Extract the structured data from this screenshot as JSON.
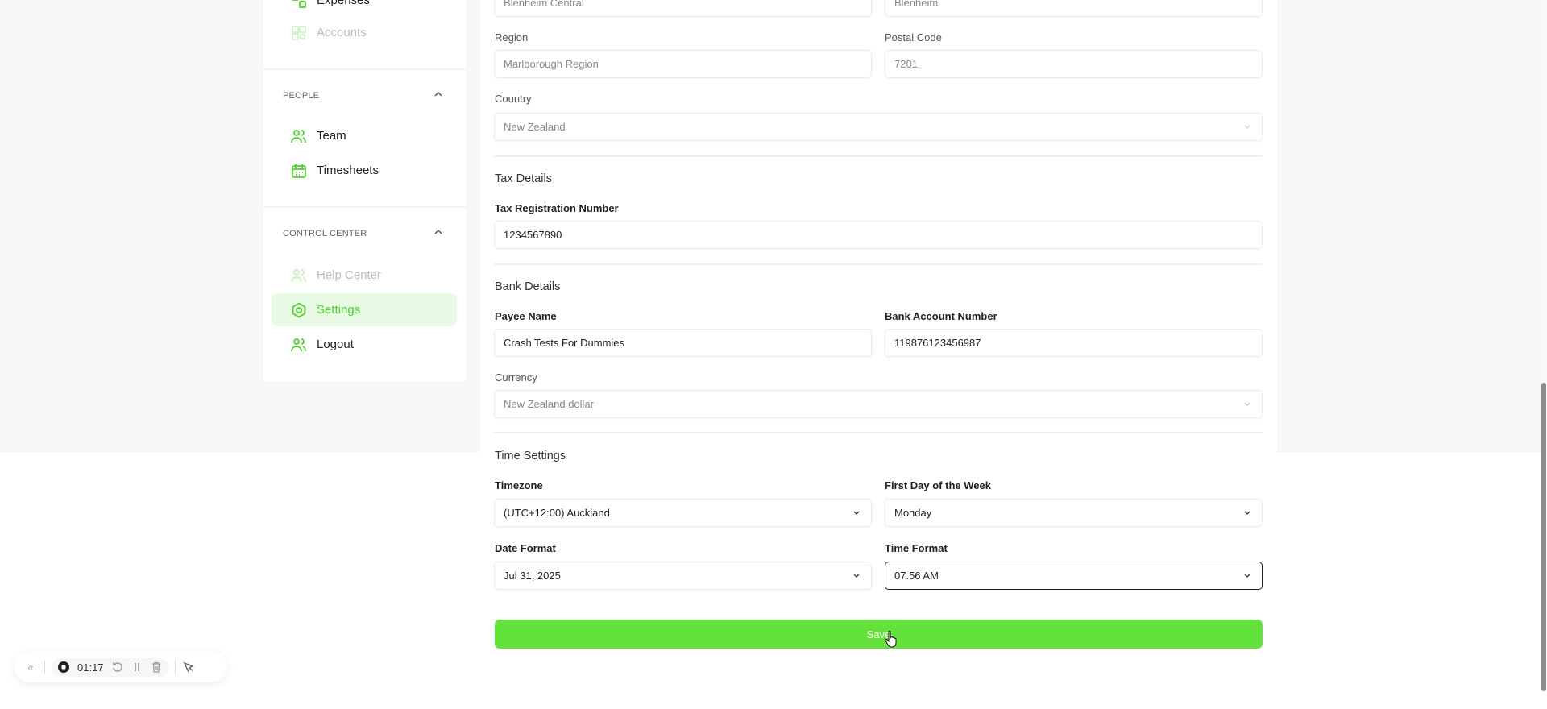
{
  "sidebar": {
    "items_top": [
      {
        "label": "Expenses"
      },
      {
        "label": "Accounts"
      }
    ],
    "people": {
      "title": "PEOPLE",
      "items": [
        {
          "label": "Team"
        },
        {
          "label": "Timesheets"
        }
      ]
    },
    "control": {
      "title": "CONTROL CENTER",
      "items": [
        {
          "label": "Help Center"
        },
        {
          "label": "Settings"
        },
        {
          "label": "Logout"
        }
      ]
    }
  },
  "address": {
    "suburb": "Blenheim Central",
    "city": "Blenheim",
    "region_label": "Region",
    "region": "Marlborough Region",
    "postal_label": "Postal Code",
    "postal": "7201",
    "country_label": "Country",
    "country": "New Zealand"
  },
  "tax": {
    "title": "Tax Details",
    "reg_label": "Tax Registration Number",
    "reg": "1234567890"
  },
  "bank": {
    "title": "Bank Details",
    "payee_label": "Payee Name",
    "payee": "Crash Tests For Dummies",
    "account_label": "Bank Account Number",
    "account": "119876123456987",
    "currency_label": "Currency",
    "currency": "New Zealand dollar"
  },
  "time": {
    "title": "Time Settings",
    "tz_label": "Timezone",
    "tz": "(UTC+12:00) Auckland",
    "fdw_label": "First Day of the Week",
    "fdw": "Monday",
    "date_label": "Date Format",
    "date": "Jul 31, 2025",
    "timefmt_label": "Time Format",
    "timefmt": "07.56 AM"
  },
  "save_label": "Save",
  "recorder": {
    "time": "01:17"
  },
  "colors": {
    "accent": "#63e23c",
    "active_bg": "#e8fae3"
  }
}
